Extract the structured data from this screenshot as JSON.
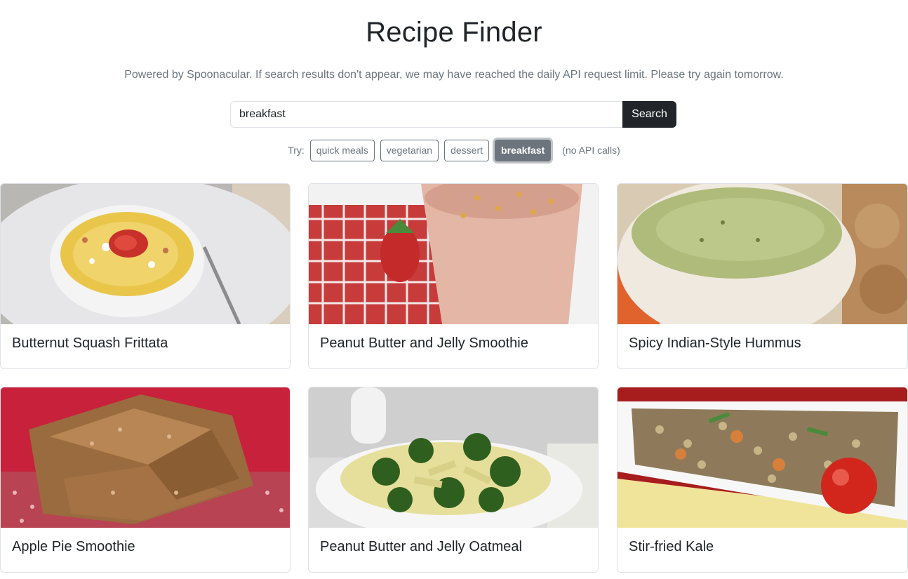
{
  "header": {
    "title": "Recipe Finder",
    "subtitle": "Powered by Spoonacular. If search results don't appear, we may have reached the daily API request limit. Please try again tomorrow."
  },
  "search": {
    "value": "breakfast",
    "button_label": "Search"
  },
  "suggestions": {
    "label": "Try:",
    "chips": [
      "quick meals",
      "vegetarian",
      "dessert",
      "breakfast"
    ],
    "active": "breakfast",
    "note": "(no API calls)"
  },
  "recipes": [
    {
      "title": "Butternut Squash Frittata",
      "image": "frittata-photo"
    },
    {
      "title": "Peanut Butter and Jelly Smoothie",
      "image": "smoothie-photo"
    },
    {
      "title": "Spicy Indian-Style Hummus",
      "image": "hummus-photo"
    },
    {
      "title": "Apple Pie Smoothie",
      "image": "bars-photo"
    },
    {
      "title": "Peanut Butter and Jelly Oatmeal",
      "image": "pasta-broccoli-photo"
    },
    {
      "title": "Stir-fried Kale",
      "image": "quinoa-salad-photo"
    }
  ],
  "colors": {
    "primary_dark": "#212529",
    "muted": "#6c757d",
    "border": "#dee2e6"
  }
}
